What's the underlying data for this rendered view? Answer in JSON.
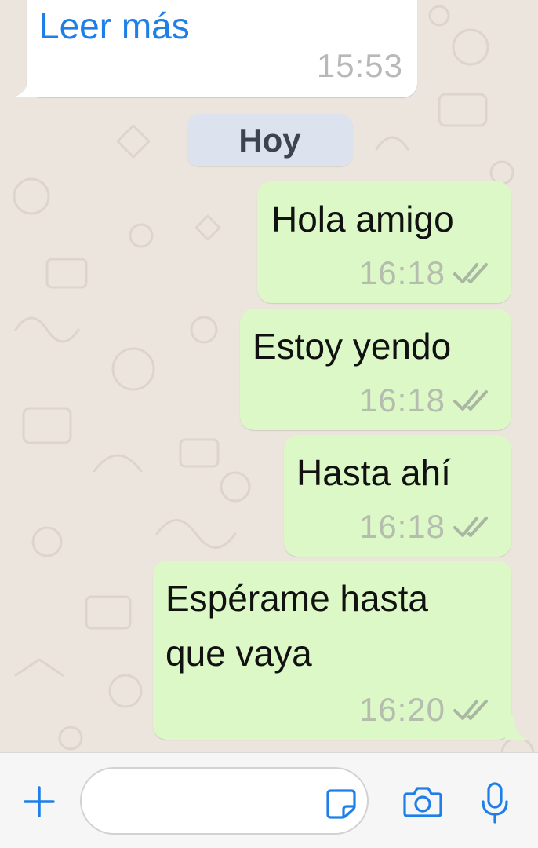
{
  "theme": {
    "accent": "#1F7FE8",
    "outgoing_bubble": "#DCF8C6",
    "incoming_bubble": "#FFFFFF",
    "chat_background": "#ECE5DD"
  },
  "incoming_message": {
    "link_label": "Leer más",
    "time": "15:53"
  },
  "date_separator": {
    "label": "Hoy"
  },
  "messages": [
    {
      "text": "Hola amigo",
      "time": "16:18",
      "status": "read-double-check-icon"
    },
    {
      "text": "Estoy yendo",
      "time": "16:18",
      "status": "read-double-check-icon"
    },
    {
      "text": "Hasta ahí",
      "time": "16:18",
      "status": "read-double-check-icon"
    },
    {
      "text_line1": "Espérame hasta",
      "text_line2": "que vaya",
      "time": "16:20",
      "status": "read-double-check-icon"
    }
  ],
  "input_bar": {
    "add_icon": "plus-icon",
    "message_value": "",
    "sticker_icon": "sticker-icon",
    "camera_icon": "camera-icon",
    "mic_icon": "microphone-icon"
  }
}
